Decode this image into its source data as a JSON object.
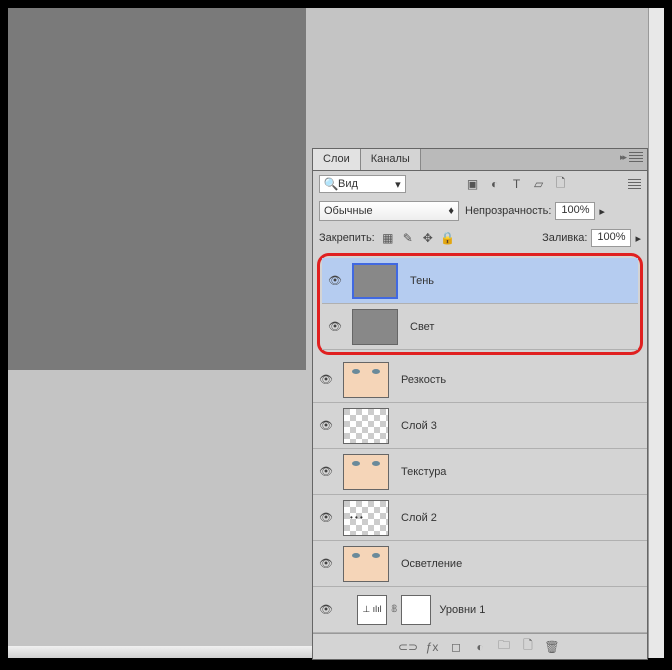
{
  "tabs": {
    "layers": "Слои",
    "channels": "Каналы"
  },
  "search": {
    "label": "Вид",
    "placeholder": ""
  },
  "blend": {
    "mode": "Обычные",
    "opacity_label": "Непрозрачность:",
    "opacity_value": "100%"
  },
  "lock": {
    "label": "Закрепить:",
    "fill_label": "Заливка:",
    "fill_value": "100%"
  },
  "layers_list": [
    {
      "name": "Тень",
      "selected": true,
      "thumb": "gray"
    },
    {
      "name": "Свет",
      "selected": false,
      "thumb": "gray"
    },
    {
      "name": "Резкость",
      "selected": false,
      "thumb": "face"
    },
    {
      "name": "Слой 3",
      "selected": false,
      "thumb": "checker"
    },
    {
      "name": "Текстура",
      "selected": false,
      "thumb": "face"
    },
    {
      "name": "Слой 2",
      "selected": false,
      "thumb": "checker-dots"
    },
    {
      "name": "Осветление",
      "selected": false,
      "thumb": "face"
    }
  ],
  "adjustment": {
    "name": "Уровни 1"
  }
}
